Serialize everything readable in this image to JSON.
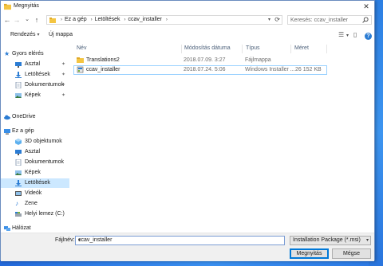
{
  "window": {
    "title": "Megnyitás",
    "close_glyph": "✕"
  },
  "toolbar": {
    "back_glyph": "←",
    "forward_glyph": "→",
    "recent_glyph": "⌄",
    "up_glyph": "↑",
    "breadcrumb": [
      "Ez a gép",
      "Letöltések",
      "ccav_installer"
    ],
    "crumb_sep": "›",
    "search_placeholder": "Keresés: ccav_installer"
  },
  "commands": {
    "organize": "Rendezés",
    "new_folder": "Új mappa",
    "help": "?"
  },
  "sidebar": {
    "quick_access": "Gyors elérés",
    "quick_items": [
      {
        "label": "Asztal",
        "icon": "desktop-icon"
      },
      {
        "label": "Letöltések",
        "icon": "download-icon"
      },
      {
        "label": "Dokumentumok",
        "icon": "document-icon"
      },
      {
        "label": "Képek",
        "icon": "pictures-icon"
      }
    ],
    "onedrive": "OneDrive",
    "this_pc": "Ez a gép",
    "pc_items": [
      {
        "label": "3D objektumok",
        "icon": "3d-objects-icon"
      },
      {
        "label": "Asztal",
        "icon": "desktop-icon"
      },
      {
        "label": "Dokumentumok",
        "icon": "document-icon"
      },
      {
        "label": "Képek",
        "icon": "pictures-icon"
      },
      {
        "label": "Letöltések",
        "icon": "download-icon"
      },
      {
        "label": "Videók",
        "icon": "videos-icon"
      },
      {
        "label": "Zene",
        "icon": "music-icon"
      },
      {
        "label": "Helyi lemez (C:)",
        "icon": "drive-icon"
      }
    ],
    "network": "Hálózat"
  },
  "columns": {
    "name": "Név",
    "modified": "Módosítás dátuma",
    "type": "Típus",
    "size": "Méret"
  },
  "files": [
    {
      "name": "Translations2",
      "modified": "2018.07.09. 3:27",
      "type": "Fájlmappa",
      "size": "",
      "icon": "folder-icon"
    },
    {
      "name": "ccav_installer",
      "modified": "2018.07.24. 5:06",
      "type": "Windows Installer ...",
      "size": "26 152 KB",
      "icon": "msi-installer-icon"
    }
  ],
  "footer": {
    "filename_label": "Fájlnév:",
    "filename_value": "ccav_installer",
    "filetype_value": "Installation Package (*.msi)",
    "open_label": "Megnyitás",
    "cancel_label": "Mégse"
  },
  "colors": {
    "accent": "#0078d7",
    "selected_bg": "#cce8ff",
    "folder": "#f4c542"
  }
}
